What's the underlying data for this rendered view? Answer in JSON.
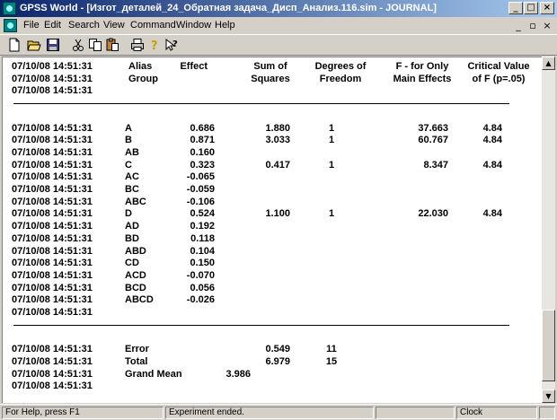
{
  "window": {
    "title": "GPSS World - [Изгот_деталей_24_Обратная задача_Дисп_Анализ.116.sim - JOURNAL]",
    "minimize": "_",
    "maximize": "□",
    "close": "×"
  },
  "menu": {
    "items": [
      "File",
      "Edit",
      "Search",
      "View",
      "Command",
      "Window",
      "Help"
    ],
    "mdi_minimize": "_",
    "mdi_restore": "▫",
    "mdi_close": "×"
  },
  "toolbar": {
    "icons": [
      "new-icon",
      "open-icon",
      "save-icon",
      "cut-icon",
      "copy-icon",
      "paste-icon",
      "print-icon",
      "help-icon",
      "context-help-icon"
    ]
  },
  "journal": {
    "header_rows": [
      {
        "time": "07/10/08 14:51:31",
        "c1": "Alias",
        "c2": "Effect",
        "c3": "Sum of",
        "c4": "Degrees of",
        "c5": "F - for Only",
        "c6": "Critical Value"
      },
      {
        "time": "07/10/08 14:51:31",
        "c1": "Group",
        "c2": "",
        "c3": "Squares",
        "c4": "Freedom",
        "c5": "Main Effects",
        "c6": "of F (p=.05)"
      },
      {
        "time": "07/10/08 14:51:31",
        "c1": "",
        "c2": "",
        "c3": "",
        "c4": "",
        "c5": "",
        "c6": ""
      }
    ],
    "effect_rows": [
      {
        "time": "07/10/08 14:51:31",
        "group": "A",
        "effect": "0.686",
        "ss": "1.880",
        "df": "1",
        "f": "37.663",
        "crit": "4.84"
      },
      {
        "time": "07/10/08 14:51:31",
        "group": "B",
        "effect": "0.871",
        "ss": "3.033",
        "df": "1",
        "f": "60.767",
        "crit": "4.84"
      },
      {
        "time": "07/10/08 14:51:31",
        "group": "AB",
        "effect": "0.160",
        "ss": "",
        "df": "",
        "f": "",
        "crit": ""
      },
      {
        "time": "07/10/08 14:51:31",
        "group": "C",
        "effect": "0.323",
        "ss": "0.417",
        "df": "1",
        "f": "8.347",
        "crit": "4.84"
      },
      {
        "time": "07/10/08 14:51:31",
        "group": "AC",
        "effect": "-0.065",
        "ss": "",
        "df": "",
        "f": "",
        "crit": ""
      },
      {
        "time": "07/10/08 14:51:31",
        "group": "BC",
        "effect": "-0.059",
        "ss": "",
        "df": "",
        "f": "",
        "crit": ""
      },
      {
        "time": "07/10/08 14:51:31",
        "group": "ABC",
        "effect": "-0.106",
        "ss": "",
        "df": "",
        "f": "",
        "crit": ""
      },
      {
        "time": "07/10/08 14:51:31",
        "group": "D",
        "effect": "0.524",
        "ss": "1.100",
        "df": "1",
        "f": "22.030",
        "crit": "4.84"
      },
      {
        "time": "07/10/08 14:51:31",
        "group": "AD",
        "effect": "0.192",
        "ss": "",
        "df": "",
        "f": "",
        "crit": ""
      },
      {
        "time": "07/10/08 14:51:31",
        "group": "BD",
        "effect": "0.118",
        "ss": "",
        "df": "",
        "f": "",
        "crit": ""
      },
      {
        "time": "07/10/08 14:51:31",
        "group": "ABD",
        "effect": "0.104",
        "ss": "",
        "df": "",
        "f": "",
        "crit": ""
      },
      {
        "time": "07/10/08 14:51:31",
        "group": "CD",
        "effect": "0.150",
        "ss": "",
        "df": "",
        "f": "",
        "crit": ""
      },
      {
        "time": "07/10/08 14:51:31",
        "group": "ACD",
        "effect": "-0.070",
        "ss": "",
        "df": "",
        "f": "",
        "crit": ""
      },
      {
        "time": "07/10/08 14:51:31",
        "group": "BCD",
        "effect": "0.056",
        "ss": "",
        "df": "",
        "f": "",
        "crit": ""
      },
      {
        "time": "07/10/08 14:51:31",
        "group": "ABCD",
        "effect": "-0.026",
        "ss": "",
        "df": "",
        "f": "",
        "crit": ""
      },
      {
        "time": "07/10/08 14:51:31",
        "group": "",
        "effect": "",
        "ss": "",
        "df": "",
        "f": "",
        "crit": ""
      }
    ],
    "summary_rows": [
      {
        "time": "07/10/08 14:51:31",
        "label": "Error",
        "value": "",
        "ss": "0.549",
        "df": "11"
      },
      {
        "time": "07/10/08 14:51:31",
        "label": "Total",
        "value": "",
        "ss": "6.979",
        "df": "15"
      },
      {
        "time": "07/10/08 14:51:31",
        "label": "Grand Mean",
        "value": "3.986",
        "ss": "",
        "df": ""
      },
      {
        "time": "07/10/08 14:51:31",
        "label": "",
        "value": "",
        "ss": "",
        "df": ""
      }
    ]
  },
  "statusbar": {
    "help": "For Help, press F1",
    "message": "Experiment ended.",
    "panel3": "",
    "clock": "Clock",
    "panel5": ""
  }
}
